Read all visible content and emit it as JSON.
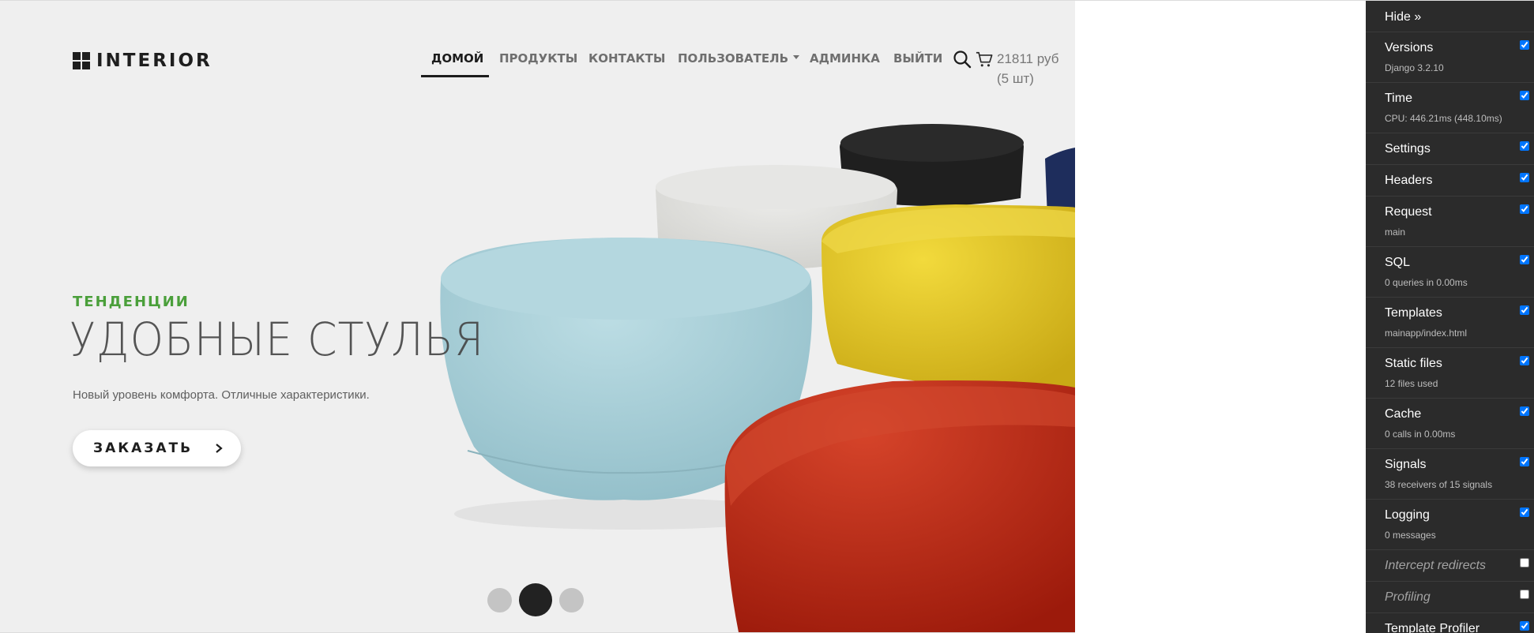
{
  "site": {
    "logo_text": "INTERIOR",
    "nav": [
      {
        "label": "ДОМОЙ",
        "active": true
      },
      {
        "label": "ПРОДУКТЫ"
      },
      {
        "label": "КОНТАКТЫ"
      },
      {
        "label": "ПОЛЬЗОВАТЕЛЬ",
        "dropdown": true
      },
      {
        "label": "АДМИНКА"
      },
      {
        "label": "ВЫЙТИ"
      }
    ],
    "cart": {
      "total": "21811 руб",
      "count": "(5 шт)"
    }
  },
  "hero": {
    "kicker": "ТЕНДЕНЦИИ",
    "headline": "УДОБНЫЕ СТУЛЬЯ",
    "subtitle": "Новый уровень комфорта. Отличные характеристики.",
    "cta_label": "ЗАКАЗАТЬ",
    "slides": {
      "count": 3,
      "active": 2
    }
  },
  "colors": {
    "accent_green": "#4a9f3a",
    "dark": "#1e1e1e",
    "toolbar_bg": "#2b2b2b",
    "chair_blue": "#a6cdd6",
    "chair_yellow": "#e2c52c",
    "chair_red": "#c12b15",
    "chair_white": "#e3e3e1",
    "chair_black": "#1f1f1f",
    "chair_navy": "#1e2d5c"
  },
  "toolbar": {
    "hide_label": "Hide »",
    "panels": [
      {
        "title": "Versions",
        "subtitle": "Django 3.2.10",
        "checked": true
      },
      {
        "title": "Time",
        "subtitle": "CPU: 446.21ms (448.10ms)",
        "checked": true
      },
      {
        "title": "Settings",
        "subtitle": "",
        "checked": true
      },
      {
        "title": "Headers",
        "subtitle": "",
        "checked": true
      },
      {
        "title": "Request",
        "subtitle": "main",
        "checked": true
      },
      {
        "title": "SQL",
        "subtitle": "0 queries in 0.00ms",
        "checked": true
      },
      {
        "title": "Templates",
        "subtitle": "mainapp/index.html",
        "checked": true
      },
      {
        "title": "Static files",
        "subtitle": "12 files used",
        "checked": true
      },
      {
        "title": "Cache",
        "subtitle": "0 calls in 0.00ms",
        "checked": true
      },
      {
        "title": "Signals",
        "subtitle": "38 receivers of 15 signals",
        "checked": true
      },
      {
        "title": "Logging",
        "subtitle": "0 messages",
        "checked": true
      },
      {
        "title": "Intercept redirects",
        "subtitle": "",
        "checked": false,
        "disabled": true
      },
      {
        "title": "Profiling",
        "subtitle": "",
        "checked": false,
        "disabled": true
      },
      {
        "title": "Template Profiler",
        "subtitle": "",
        "checked": true
      }
    ]
  }
}
